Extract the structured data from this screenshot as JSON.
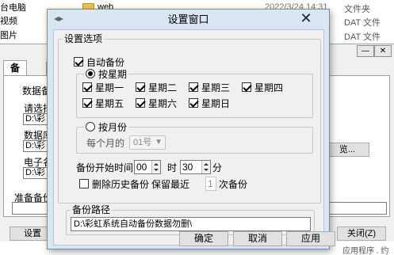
{
  "explorer": {
    "sidebar_items": [
      "台电脑",
      "视频",
      "图片"
    ],
    "file_name": "web",
    "file_date": "2022/3/24 14:31",
    "types": [
      "文件夹",
      "DAT 文件",
      "DAT 文件"
    ]
  },
  "bg_window": {
    "tabs": [
      "备份"
    ],
    "labels": [
      "数据备",
      "请选择",
      "数据库",
      "电子名"
    ],
    "paths": [
      "D:\\彩",
      "D:\\彩",
      "D:\\彩"
    ],
    "browse_btn_label": "览...",
    "status_label": "准备备份",
    "settings_btn": "设置",
    "close_btn": "关闭(Z)",
    "bottom_text": "应用程序 . 约"
  },
  "dialog": {
    "title": "设置窗口",
    "close_glyph": "✕",
    "options_group": "设置选项",
    "auto_backup": {
      "label": "自动备份",
      "checked": true
    },
    "by_week": {
      "label": "按星期",
      "selected": true
    },
    "weekdays": [
      {
        "label": "星期一",
        "checked": true
      },
      {
        "label": "星期二",
        "checked": true
      },
      {
        "label": "星期三",
        "checked": true
      },
      {
        "label": "星期四",
        "checked": true
      },
      {
        "label": "星期五",
        "checked": true
      },
      {
        "label": "星期六",
        "checked": true
      },
      {
        "label": "星期日",
        "checked": true
      }
    ],
    "by_month": {
      "label": "按月份",
      "selected": false
    },
    "every_month_label": "每个月的",
    "month_day_value": "01号",
    "start_time_label": "备份开始时间:",
    "hour_value": "00",
    "hour_unit": "时",
    "minute_value": "30",
    "minute_unit": "分",
    "delete_history": {
      "label": "删除历史备份",
      "checked": false
    },
    "keep_recent_label": "保留最近",
    "keep_value": "1",
    "keep_unit": "次备份",
    "path_group": "备份路径",
    "path_value": "D:\\彩虹系统自动备份数据勿删\\",
    "ok_btn": "确定",
    "cancel_btn": "取消",
    "apply_btn": "应用"
  },
  "colors": {
    "dialog_frame": "#dae6f3",
    "client_bg": "#f0f0f0",
    "button_bg": "#e1e1e1"
  }
}
